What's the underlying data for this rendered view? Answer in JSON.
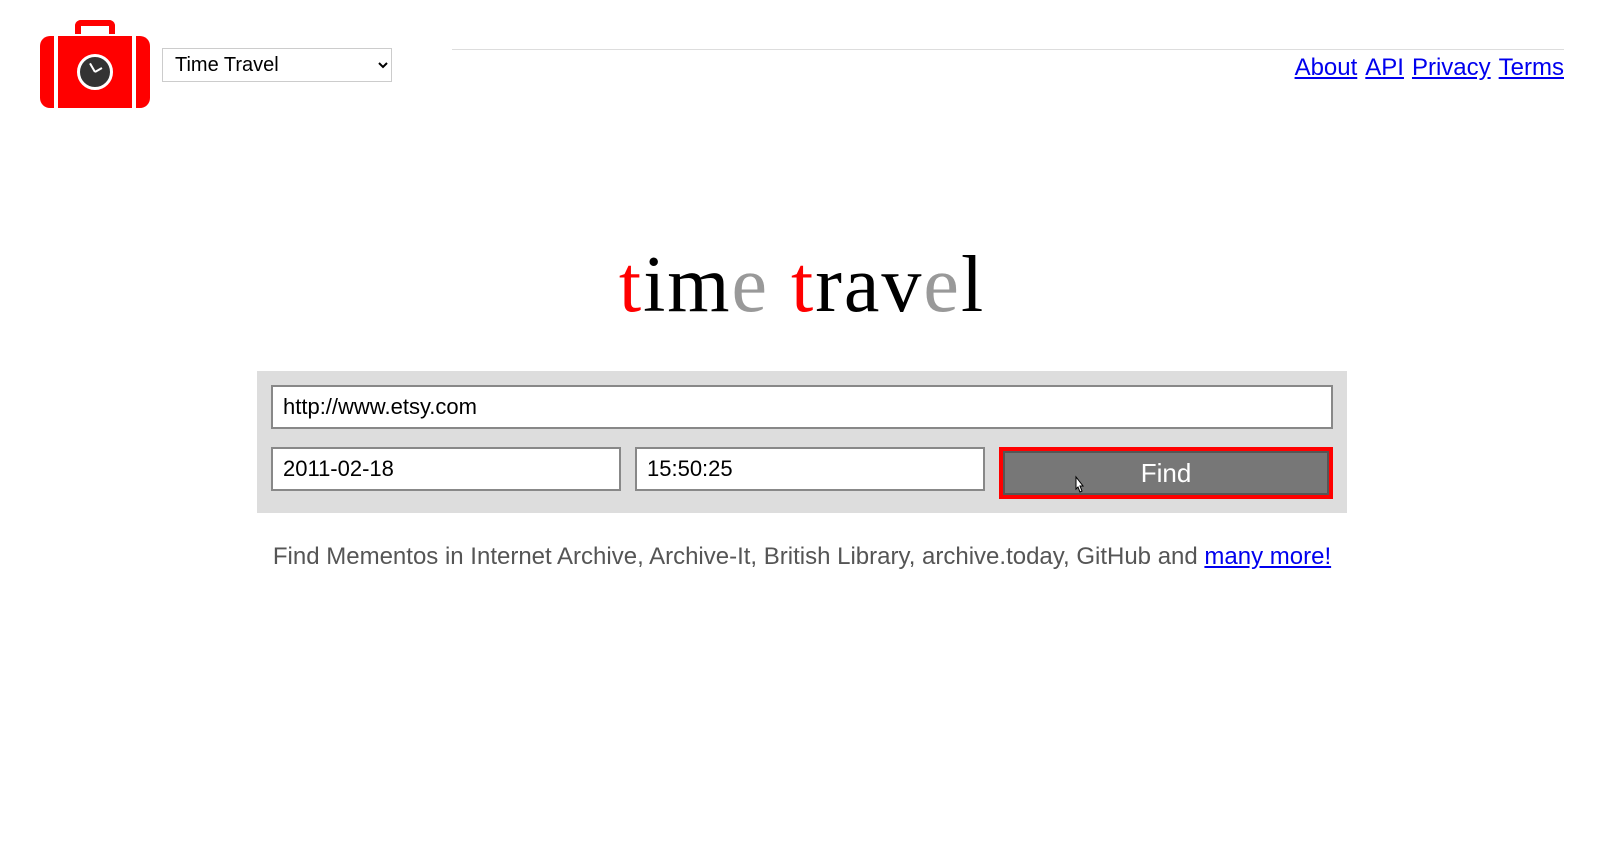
{
  "header": {
    "dropdown_selected": "Time Travel",
    "links": {
      "about": "About",
      "api": "API",
      "privacy": "Privacy",
      "terms": "Terms"
    }
  },
  "title": {
    "word1": {
      "t": "t",
      "im": "im",
      "e": "e"
    },
    "word2": {
      "t": "t",
      "rav": "rav",
      "e": "e",
      "l": "l"
    }
  },
  "form": {
    "url_value": "http://www.etsy.com",
    "date_value": "2011-02-18",
    "time_value": "15:50:25",
    "find_label": "Find"
  },
  "tagline": {
    "text": "Find Mementos in Internet Archive, Archive-It, British Library, archive.today, GitHub and ",
    "link": "many more!"
  }
}
